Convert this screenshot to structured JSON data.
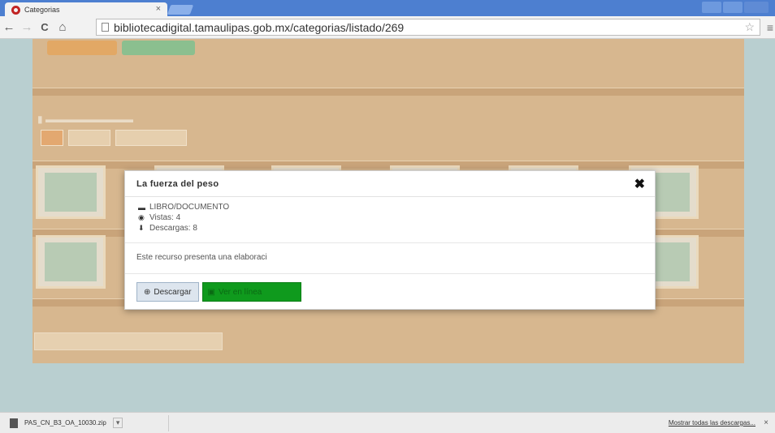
{
  "browser": {
    "tab_title": "Categorias",
    "tab_close": "×",
    "url": "bibliotecadigital.tamaulipas.gob.mx/categorias/listado/269",
    "back": "←",
    "forward": "→",
    "reload": "C",
    "home": "⌂",
    "star": "☆",
    "menu": "≡"
  },
  "modal": {
    "title": "La fuerza del peso",
    "close": "✖",
    "meta": [
      {
        "icon": "folder-icon",
        "glyph": "▬",
        "text": "LIBRO/DOCUMENTO"
      },
      {
        "icon": "eye-icon",
        "glyph": "◉",
        "text": "Vistas: 4"
      },
      {
        "icon": "download-icon",
        "glyph": "⬇",
        "text": "Descargas: 8"
      }
    ],
    "description": "Este recurso presenta una elaboraci",
    "download_label": "Descargar",
    "download_glyph": "⊕",
    "view_label": "Ver en línea",
    "view_glyph": "▣"
  },
  "download_bar": {
    "file_name": "PAS_CN_B3_OA_10030.zip",
    "arrow": "▾",
    "show_all": "Mostrar todas las descargas...",
    "close": "×"
  }
}
